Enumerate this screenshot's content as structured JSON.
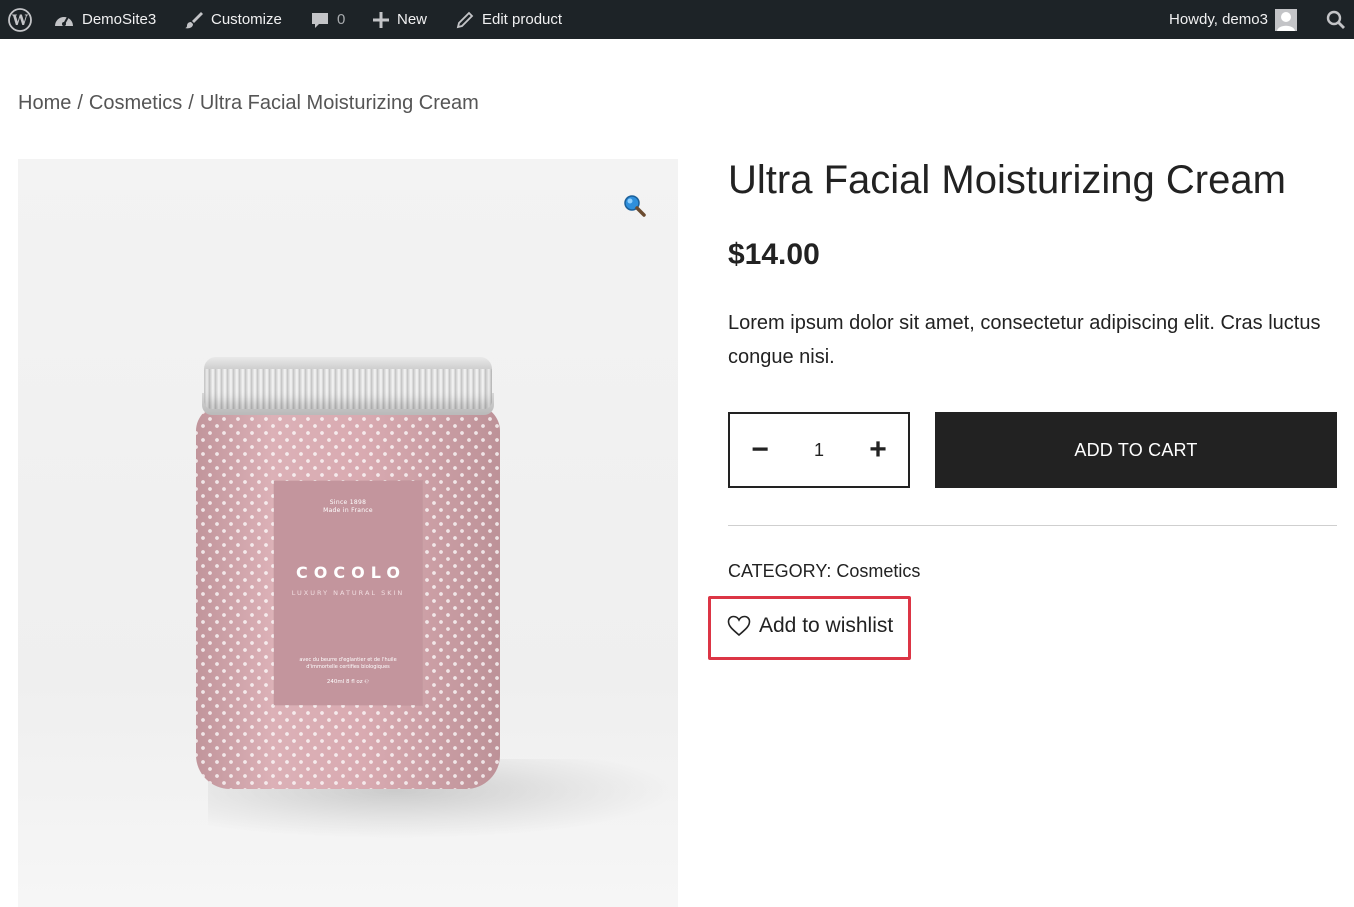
{
  "adminbar": {
    "site_name": "DemoSite3",
    "customize": "Customize",
    "comments_count": "0",
    "new": "New",
    "edit": "Edit product",
    "greeting": "Howdy, demo3"
  },
  "breadcrumb": {
    "home": "Home",
    "category": "Cosmetics",
    "current": "Ultra Facial Moisturizing Cream",
    "separator": "/"
  },
  "product": {
    "title": "Ultra Facial Moisturizing Cream",
    "price": "$14.00",
    "short_description": "Lorem ipsum dolor sit amet, consectetur adipiscing elit. Cras luctus congue nisi.",
    "quantity": "1",
    "qty_minus": "−",
    "qty_plus": "+",
    "add_to_cart": "ADD TO CART",
    "category_label": "CATEGORY:",
    "category_value": "Cosmetics",
    "wishlist": "Add to wishlist"
  },
  "image_label": {
    "since": "Since 1898",
    "made_in": "Made in France",
    "brand": "COCOLO",
    "tagline": "LUXURY NATURAL SKIN",
    "description": "avec du beurre d'eglantier et de l'huile d'immortelle certifies biologiques",
    "size": "240ml 8 fl oz ℮"
  },
  "colors": {
    "adminbar_bg": "#1d2327",
    "button_bg": "#222222",
    "highlight": "#dc3545"
  }
}
